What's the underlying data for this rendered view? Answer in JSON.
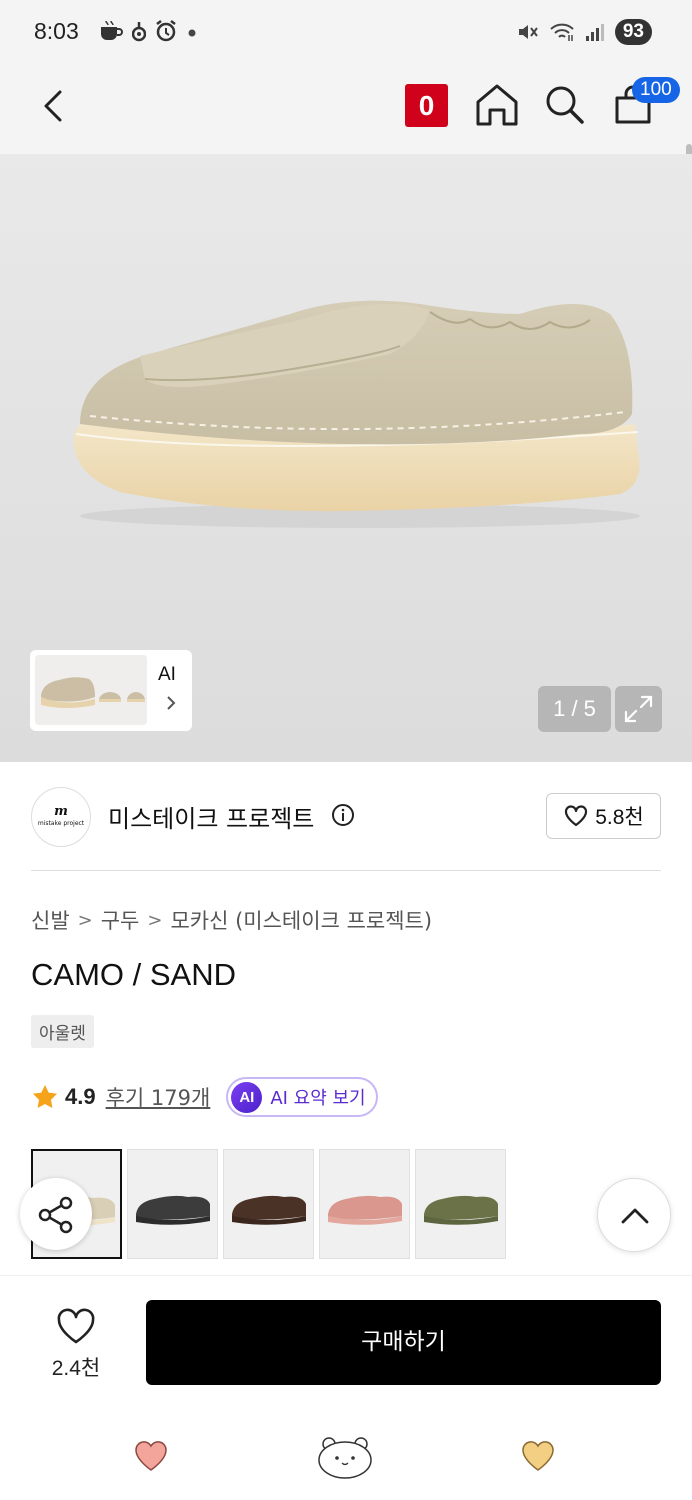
{
  "status_bar": {
    "time": "8:03",
    "battery": "93",
    "icons_left": [
      "coffee-icon",
      "notification-icon",
      "alarm-icon",
      "dot-icon"
    ],
    "icons_right": [
      "mute-icon",
      "wifi-icon",
      "signal-icon"
    ]
  },
  "header": {
    "badge_count": "0",
    "cart_count": "100",
    "icons": [
      "back-icon",
      "home-icon",
      "search-icon",
      "cart-icon"
    ]
  },
  "gallery": {
    "counter": "1 / 5",
    "ai_label": "AI",
    "current_index": 1,
    "total": 5
  },
  "brand": {
    "logo_text": "m",
    "logo_subtext": "mistake project",
    "name": "미스테이크 프로젝트",
    "likes": "5.8천"
  },
  "breadcrumb": [
    "신발",
    "구두",
    "모카신 (미스테이크 프로젝트)"
  ],
  "product": {
    "title": "CAMO / SAND",
    "tag": "아울렛",
    "rating": "4.9",
    "reviews_label": "후기 179개",
    "ai_badge": "AI",
    "ai_summary_label": "AI 요약 보기"
  },
  "swatches": [
    {
      "color": "sand",
      "upper": "#d9cfb6",
      "sole": "#efe3c8",
      "selected": true
    },
    {
      "color": "black",
      "upper": "#3c3c3c",
      "sole": "#2c2c2c",
      "selected": false
    },
    {
      "color": "brown",
      "upper": "#4a3226",
      "sole": "#3a261c",
      "selected": false
    },
    {
      "color": "pink",
      "upper": "#d9978e",
      "sole": "#e3a79e",
      "selected": false
    },
    {
      "color": "olive",
      "upper": "#6b7247",
      "sole": "#5d6540",
      "selected": false
    }
  ],
  "bottom_bar": {
    "wish_count": "2.4천",
    "buy_label": "구매하기"
  },
  "colors": {
    "accent_red": "#d0021b",
    "cart_blue": "#1565e6",
    "ai_purple": "#5a2bd1",
    "star": "#f5a31a"
  }
}
